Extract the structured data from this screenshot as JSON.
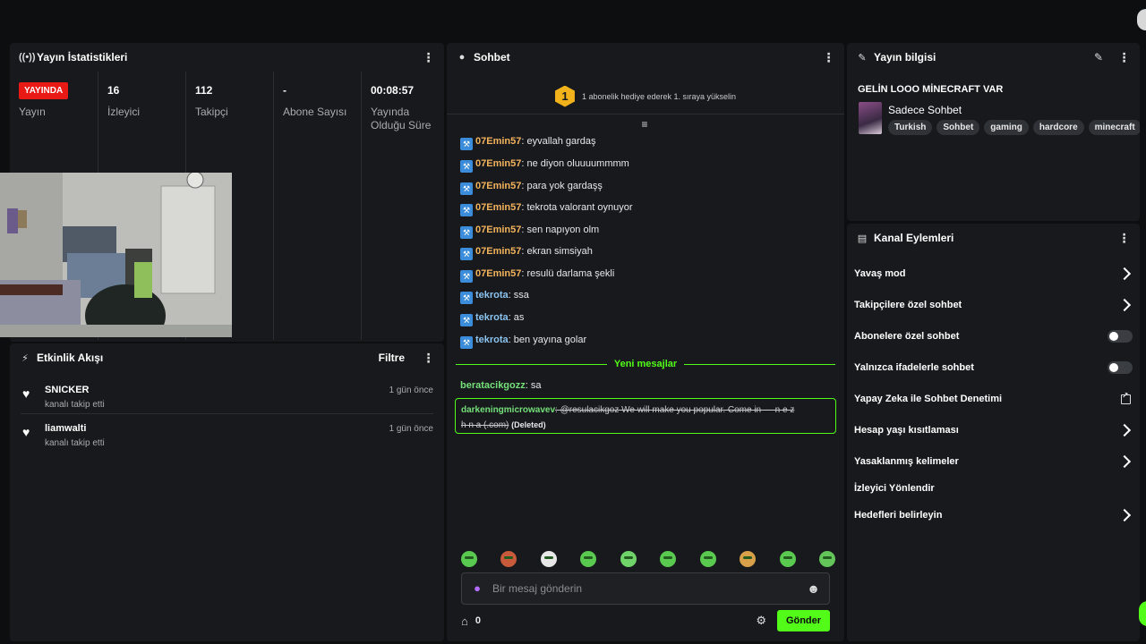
{
  "stats": {
    "title": "Yayın İstatistikleri",
    "live_badge": "YAYINDA",
    "stream_label": "Yayın",
    "viewers_value": "16",
    "viewers_label": "İzleyici",
    "followers_value": "112",
    "followers_label": "Takipçi",
    "subs_value": "-",
    "subs_label": "Abone Sayısı",
    "duration_value": "00:08:57",
    "duration_label_1": "Yayında",
    "duration_label_2": "Olduğu Süre"
  },
  "activity": {
    "title": "Etkinlik Akışı",
    "filter_label": "Filtre",
    "items": [
      {
        "name": "SNICKER",
        "sub": "kanalı takip etti",
        "time": "1 gün önce"
      },
      {
        "name": "liamwalti",
        "sub": "kanalı takip etti",
        "time": "1 gün önce"
      }
    ]
  },
  "chat": {
    "title": "Sohbet",
    "hype_badge": "1",
    "hype_text": "1 abonelik hediye ederek 1. sıraya yükselin",
    "messages": [
      {
        "user": "07Emin57",
        "text": ": eyvallah gardaş"
      },
      {
        "user": "07Emin57",
        "text": ": ne diyon oluuuummmm"
      },
      {
        "user": "07Emin57",
        "text": ": para yok gardaşş"
      },
      {
        "user": "07Emin57",
        "text": ": tekrota valorant oynuyor"
      },
      {
        "user": "07Emin57",
        "text": ": sen napıyon olm"
      },
      {
        "user": "07Emin57",
        "text": ": ekran simsiyah"
      },
      {
        "user": "07Emin57",
        "text": ": resulü darlama şekli"
      },
      {
        "user": "tekrota",
        "text": ": ssa"
      },
      {
        "user": "tekrota",
        "text": ": as"
      },
      {
        "user": "tekrota",
        "text": ": ben yayına golar"
      }
    ],
    "new_messages_label": "Yeni mesajlar",
    "new_message": {
      "user": "beratacikgozz",
      "text": ": sa"
    },
    "deleted_message": {
      "user": "darkeningmicrowavev",
      "text_line1": ": @resulacikgoz We will make you popular. Come in —  n e z",
      "text_line2": "h n a (.com)",
      "deleted_tag": "(Deleted)"
    },
    "input_placeholder": "Bir mesaj gönderin",
    "store_count": "0",
    "send_label": "Gönder"
  },
  "info": {
    "title": "Yayın bilgisi",
    "stream_title": "GELİN LOOO MİNECRAFT VAR",
    "category": "Sadece Sohbet",
    "tags": [
      "Turkish",
      "Sohbet",
      "gaming",
      "hardcore",
      "minecraft"
    ]
  },
  "actions": {
    "title": "Kanal Eylemleri",
    "items": [
      {
        "label": "Yavaş mod",
        "control": "chevron"
      },
      {
        "label": "Takipçilere özel sohbet",
        "control": "chevron"
      },
      {
        "label": "Abonelere özel sohbet",
        "control": "toggle"
      },
      {
        "label": "Yalnızca ifadelerle sohbet",
        "control": "toggle"
      },
      {
        "label": "Yapay Zeka ile Sohbet Denetimi",
        "control": "external"
      },
      {
        "label": "Hesap yaşı kısıtlaması",
        "control": "chevron"
      },
      {
        "label": "Yasaklanmış kelimeler",
        "control": "chevron"
      },
      {
        "label": "İzleyici Yönlendir",
        "control": "none"
      },
      {
        "label": "Hedefleri belirleyin",
        "control": "chevron"
      }
    ]
  },
  "colors": {
    "accent": "#53fc18",
    "live": "#e91916",
    "panel": "#17191c"
  }
}
